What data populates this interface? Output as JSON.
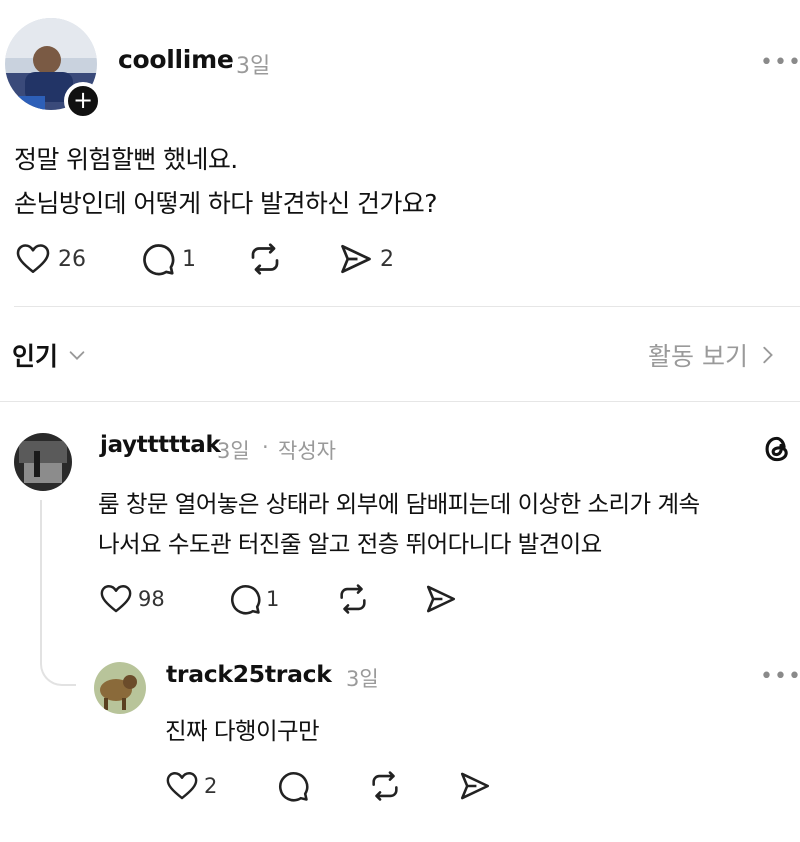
{
  "post": {
    "username": "coollime",
    "time": "3일",
    "more_icon": "more-horizontal-icon",
    "lines": [
      "정말 위험할뻔 했네요.",
      "손님방인데 어떻게 하다 발견하신 건가요?"
    ],
    "likes": "26",
    "replies": "1",
    "shares": "2"
  },
  "sort": {
    "label": "인기",
    "activity_label": "활동 보기"
  },
  "comments": [
    {
      "username": "jaytttttak",
      "time": "3일",
      "separator": "·",
      "badge": "작성자",
      "lines": [
        "룸 창문 열어놓은 상태라 외부에 담배피는데 이상한 소리가 계속",
        "나서요 수도관 터진줄 알고 전층 뛰어다니다 발견이요"
      ],
      "likes": "98",
      "replies": "1"
    },
    {
      "username": "track25track",
      "time": "3일",
      "lines": [
        "진짜 다행이구만"
      ],
      "likes": "2"
    }
  ],
  "colors": {
    "text": "#111111",
    "muted": "#9a9a9a",
    "divider": "#e6e6e6",
    "icon": "#222222"
  }
}
